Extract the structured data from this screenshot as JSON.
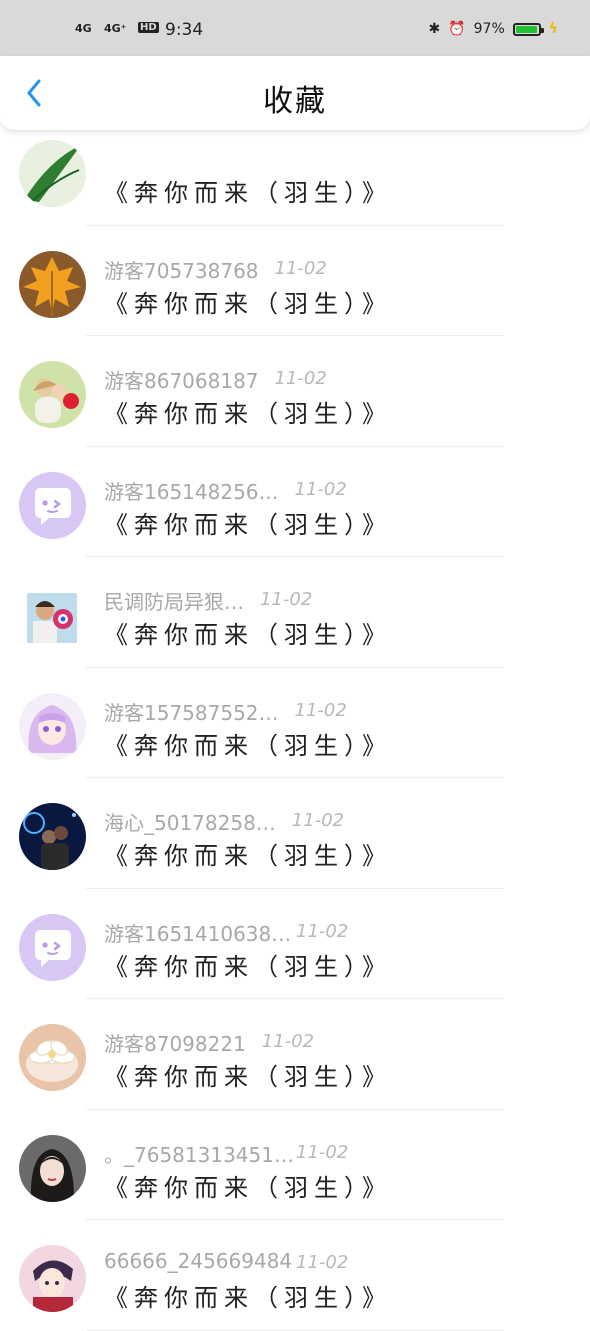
{
  "status": {
    "net1": "4G",
    "net2": "4G⁺",
    "hd": "HD",
    "time": "9:34",
    "battery_pct": "97%",
    "battery_level": 0.97,
    "icons": [
      "bluetooth-icon",
      "alarm-icon",
      "battery-icon",
      "charging-icon"
    ]
  },
  "header": {
    "title": "收藏",
    "back_icon": "chevron-left-icon"
  },
  "accent_color": "#2196f3",
  "items": [
    {
      "name": "",
      "date": "",
      "song": "《奔你而来（羽生）》",
      "avatar": "green-leaf"
    },
    {
      "name": "游客705738768",
      "date": "11-02",
      "song": "《奔你而来（羽生）》",
      "avatar": "maple-leaf"
    },
    {
      "name": "游客867068187",
      "date": "11-02",
      "song": "《奔你而来（羽生）》",
      "avatar": "couple-photo"
    },
    {
      "name": "游客165148256…",
      "date": "11-02",
      "song": "《奔你而来（羽生）》",
      "avatar": "default-chat"
    },
    {
      "name": "民调防局异狠…",
      "date": "11-02",
      "song": "《奔你而来（羽生）》",
      "avatar": "man-flower"
    },
    {
      "name": "游客157587552…",
      "date": "11-02",
      "song": "《奔你而来（羽生）》",
      "avatar": "anime-girl"
    },
    {
      "name": "海心_50178258…",
      "date": "11-02",
      "song": "《奔你而来（羽生）》",
      "avatar": "night-photo"
    },
    {
      "name": "游客1651410638…",
      "date": "11-02",
      "song": "《奔你而来（羽生）》",
      "avatar": "default-chat"
    },
    {
      "name": "游客87098221",
      "date": "11-02",
      "song": "《奔你而来（羽生）》",
      "avatar": "flower-cup"
    },
    {
      "name": "。_76581313451…",
      "date": "11-02",
      "song": "《奔你而来（羽生）》",
      "avatar": "girl-portrait"
    },
    {
      "name": "66666_245669484",
      "date": "11-02",
      "song": "《奔你而来（羽生）》",
      "avatar": "anime-boy"
    }
  ]
}
